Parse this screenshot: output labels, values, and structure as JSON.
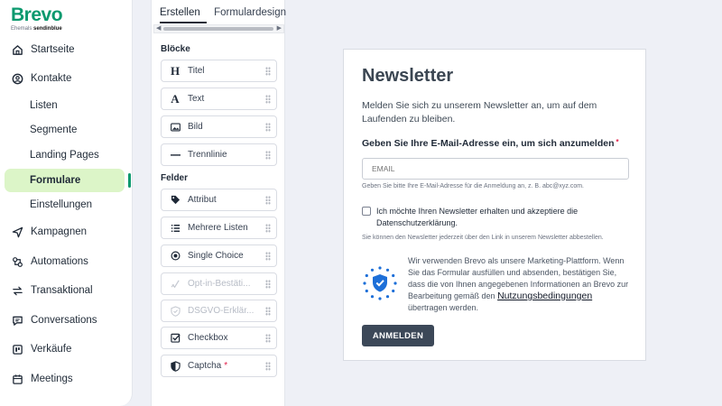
{
  "brand": {
    "name": "Brevo",
    "tagline_prefix": "Ehemals",
    "tagline_brand": "sendinblue",
    "color": "#0b996e"
  },
  "nav": {
    "items": [
      {
        "label": "Startseite",
        "icon": "home-icon"
      },
      {
        "label": "Kontakte",
        "icon": "contacts-icon"
      },
      {
        "label": "Listen",
        "sub": true
      },
      {
        "label": "Segmente",
        "sub": true
      },
      {
        "label": "Landing Pages",
        "sub": true
      },
      {
        "label": "Formulare",
        "sub": true,
        "active": true
      },
      {
        "label": "Einstellungen",
        "sub": true
      },
      {
        "label": "Kampagnen",
        "icon": "send-icon"
      },
      {
        "label": "Automations",
        "icon": "automations-icon"
      },
      {
        "label": "Transaktional",
        "icon": "transactional-icon"
      },
      {
        "label": "Conversations",
        "icon": "conversations-icon"
      },
      {
        "label": "Verkäufe",
        "icon": "sales-icon"
      },
      {
        "label": "Meetings",
        "icon": "calendar-icon"
      }
    ]
  },
  "editor": {
    "tabs": [
      "Erstellen",
      "Formulardesign"
    ],
    "blocks_label": "Blöcke",
    "blocks": [
      {
        "label": "Titel",
        "icon": "heading-icon"
      },
      {
        "label": "Text",
        "icon": "text-icon"
      },
      {
        "label": "Bild",
        "icon": "image-icon"
      },
      {
        "label": "Trennlinie",
        "icon": "divider-icon"
      }
    ],
    "fields_label": "Felder",
    "fields": [
      {
        "label": "Attribut",
        "icon": "tag-icon"
      },
      {
        "label": "Mehrere Listen",
        "icon": "list-icon"
      },
      {
        "label": "Single Choice",
        "icon": "radio-icon"
      },
      {
        "label": "Opt-in-Bestäti...",
        "icon": "optin-icon",
        "disabled": true
      },
      {
        "label": "DSGVO-Erklär...",
        "icon": "shield-check-icon",
        "disabled": true
      },
      {
        "label": "Checkbox",
        "icon": "checkbox-icon"
      },
      {
        "label": "Captcha",
        "icon": "shield-icon",
        "required_mark": "*"
      }
    ]
  },
  "form": {
    "title": "Newsletter",
    "intro": "Melden Sie sich zu unserem Newsletter an, um auf dem Laufenden zu bleiben.",
    "email_label": "Gebe n Sie Ihre E-Mail-Adresse ein, um sich anzumelden",
    "email_required_mark": "*",
    "email_placeholder": "EMAIL",
    "email_help": "Geben Sie bitte Ihre E-Mail-Adresse für die Anmeldung an, z. B. abc@xyz.com.",
    "consent_label": "Ich möchte Ihren Newsletter erhalten und akzeptiere die Datenschutzerklärung.",
    "unsubscribe_note": "Sie können den Newsletter jederzeit über den Link in unserem Newsletter abbestellen.",
    "legal_text": "Wir verwenden Brevo als unsere Marketing-Plattform. Wenn Sie das Formular ausfüllen und absenden, bestätigen Sie, dass die von Ihnen angegebenen Informationen an Brevo zur Bearbeitung gemäß den",
    "legal_link": "Nutzungsbedingungen",
    "legal_suffix": "übertragen werden.",
    "submit_label": "ANMELDEN"
  }
}
